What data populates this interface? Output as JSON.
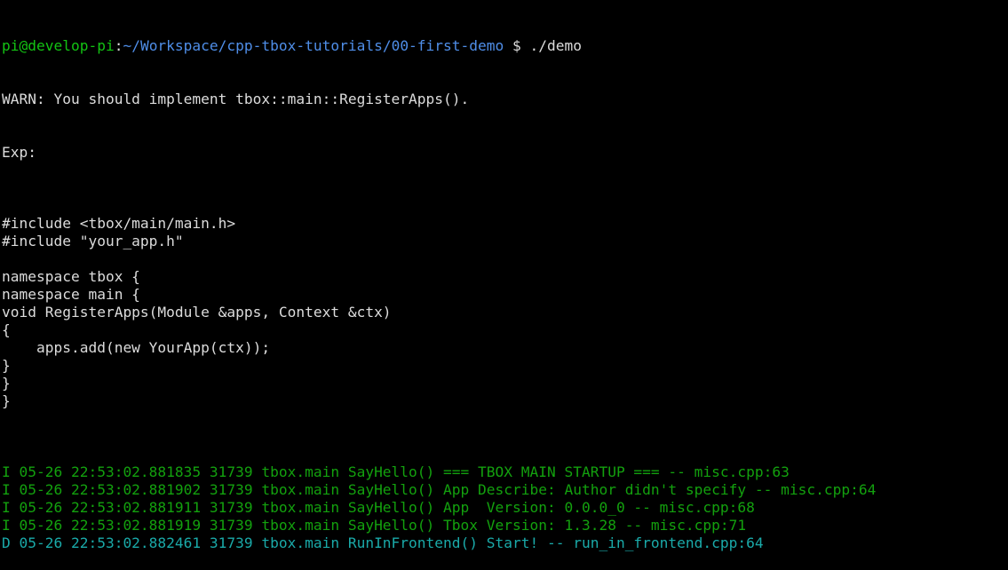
{
  "colors": {
    "background": "#000000",
    "text": "#dcdcdc",
    "prompt_user": "#13c313",
    "prompt_path": "#4f8ee8",
    "log_info": "#13a10e",
    "log_debug": "#1aaaa9"
  },
  "prompt": {
    "user_host": "pi@develop-pi",
    "separator": ":",
    "path": "~/Workspace/cpp-tbox-tutorials/00-first-demo",
    "symbol": " $ ",
    "command": "./demo"
  },
  "output": {
    "warn": "WARN: You should implement tbox::main::RegisterApps().",
    "exp": "Exp:",
    "code": [
      "",
      "#include <tbox/main/main.h>",
      "#include \"your_app.h\"",
      "",
      "namespace tbox {",
      "namespace main {",
      "void RegisterApps(Module &apps, Context &ctx)",
      "{",
      "    apps.add(new YourApp(ctx));",
      "}",
      "}",
      "}",
      ""
    ],
    "logs": [
      {
        "level": "info",
        "text": "I 05-26 22:53:02.881835 31739 tbox.main SayHello() === TBOX MAIN STARTUP === -- misc.cpp:63"
      },
      {
        "level": "info",
        "text": "I 05-26 22:53:02.881902 31739 tbox.main SayHello() App Describe: Author didn't specify -- misc.cpp:64"
      },
      {
        "level": "info",
        "text": "I 05-26 22:53:02.881911 31739 tbox.main SayHello() App  Version: 0.0.0_0 -- misc.cpp:68"
      },
      {
        "level": "info",
        "text": "I 05-26 22:53:02.881919 31739 tbox.main SayHello() Tbox Version: 1.3.28 -- misc.cpp:71"
      },
      {
        "level": "debug",
        "text": "D 05-26 22:53:02.882461 31739 tbox.main RunInFrontend() Start! -- run_in_frontend.cpp:64"
      }
    ]
  }
}
